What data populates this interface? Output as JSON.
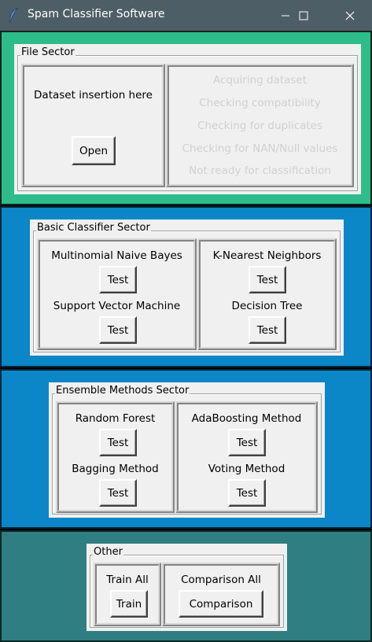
{
  "window": {
    "title": "Spam Classifier Software",
    "icon": "feather-icon"
  },
  "file_sector": {
    "legend": "File Sector",
    "prompt": "Dataset insertion here",
    "open_label": "Open",
    "status": [
      "Acquiring dataset",
      "Checking compatibility",
      "Checking for duplicates",
      "Checking for NAN/Null values",
      "Not ready for classification"
    ]
  },
  "basic_sector": {
    "legend": "Basic Classifier Sector",
    "classifiers": [
      {
        "name": "Multinomial Naive Bayes",
        "button": "Test"
      },
      {
        "name": "K-Nearest Neighbors",
        "button": "Test"
      },
      {
        "name": "Support Vector Machine",
        "button": "Test"
      },
      {
        "name": "Decision Tree",
        "button": "Test"
      }
    ]
  },
  "ensemble_sector": {
    "legend": "Ensemble Methods Sector",
    "methods": [
      {
        "name": "Random Forest",
        "button": "Test"
      },
      {
        "name": "AdaBoosting Method",
        "button": "Test"
      },
      {
        "name": "Bagging Method",
        "button": "Test"
      },
      {
        "name": "Voting Method",
        "button": "Test"
      }
    ]
  },
  "other_sector": {
    "legend": "Other",
    "train_all_label": "Train All",
    "train_button": "Train",
    "comparison_all_label": "Comparison All",
    "comparison_button": "Comparison"
  },
  "colors": {
    "titlebar": "#4e5e66",
    "file_sector_bg": "#2ebd8a",
    "classifier_sectors_bg": "#0b86c7",
    "other_sector_bg": "#2f7f82",
    "panel_bg": "#f0f0f0",
    "disabled_text": "#d0d0d0"
  }
}
